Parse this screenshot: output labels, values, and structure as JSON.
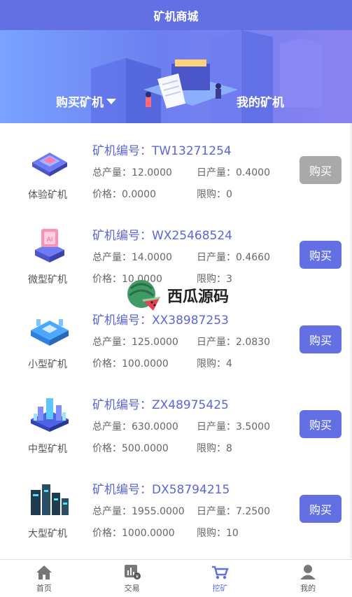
{
  "header": {
    "title": "矿机商城"
  },
  "banner": {
    "tabs": [
      {
        "label": "购买矿机"
      },
      {
        "label": "我的矿机"
      }
    ]
  },
  "machines": [
    {
      "name": "体验矿机",
      "code_label": "矿机编号：",
      "code": "TW13271254",
      "total": "总产量：12.0000",
      "daily": "日产量：0.4000",
      "price": "价格：0.0000",
      "limit": "限购：0",
      "button": "购买",
      "button_state": "disabled"
    },
    {
      "name": "微型矿机",
      "code_label": "矿机编号：",
      "code": "WX25468524",
      "total": "总产量：14.0000",
      "daily": "日产量：0.4660",
      "price": "价格：10.0000",
      "limit": "限购：3",
      "button": "购买",
      "button_state": "enabled"
    },
    {
      "name": "小型矿机",
      "code_label": "矿机编号：",
      "code": "XX38987253",
      "total": "总产量：125.0000",
      "daily": "日产量：2.0830",
      "price": "价格：100.0000",
      "limit": "限购：4",
      "button": "购买",
      "button_state": "enabled"
    },
    {
      "name": "中型矿机",
      "code_label": "矿机编号：",
      "code": "ZX48975425",
      "total": "总产量：630.0000",
      "daily": "日产量：3.5000",
      "price": "价格：500.0000",
      "limit": "限购：8",
      "button": "购买",
      "button_state": "enabled"
    },
    {
      "name": "大型矿机",
      "code_label": "矿机编号：",
      "code": "DX58794215",
      "total": "总产量：1955.0000",
      "daily": "日产量：7.2500",
      "price": "价格：1000.0000",
      "limit": "限购：10",
      "button": "购买",
      "button_state": "enabled"
    }
  ],
  "watermark": {
    "text": "西瓜源码"
  },
  "tabbar": {
    "items": [
      {
        "label": "首页",
        "icon": "home-icon"
      },
      {
        "label": "交易",
        "icon": "trade-chart-icon"
      },
      {
        "label": "挖矿",
        "icon": "mining-cart-icon",
        "active": true
      },
      {
        "label": "我的",
        "icon": "user-icon"
      }
    ]
  },
  "colors": {
    "primary": "#6370e3",
    "disabled": "#a9a9a9",
    "code_text": "#5b66d6"
  }
}
